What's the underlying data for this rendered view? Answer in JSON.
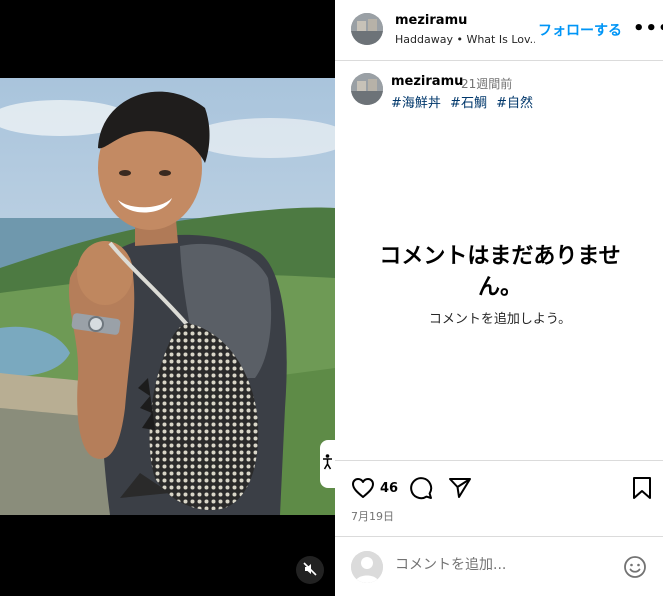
{
  "post": {
    "username": "meziramu",
    "song": "Haddaway • What Is Lov...",
    "follow_label": "フォローする",
    "more_label": "•••",
    "caption": {
      "username": "meziramu",
      "time": "21週間前",
      "hashtags": [
        "#海鮮丼",
        "#石鯛",
        "#自然"
      ]
    },
    "empty_comments": {
      "title": "コメントはまだありません。",
      "subtitle": "コメントを追加しよう。"
    },
    "likes": "46",
    "date": "7月19日",
    "comment_input": {
      "placeholder": "コメントを追加..."
    }
  },
  "icons": {
    "mute": "speaker-muted-icon",
    "accessibility": "accessibility-icon",
    "more": "more-dots-icon",
    "like": "heart-icon",
    "comment": "comment-bubble-icon",
    "share": "paper-plane-icon",
    "save": "bookmark-icon",
    "emoji": "smiley-icon",
    "user": "user-avatar-icon"
  },
  "colors": {
    "link_blue": "#0095f6",
    "hashtag": "#00376b",
    "muted_text": "#737373",
    "divider": "#dbdbdb"
  }
}
